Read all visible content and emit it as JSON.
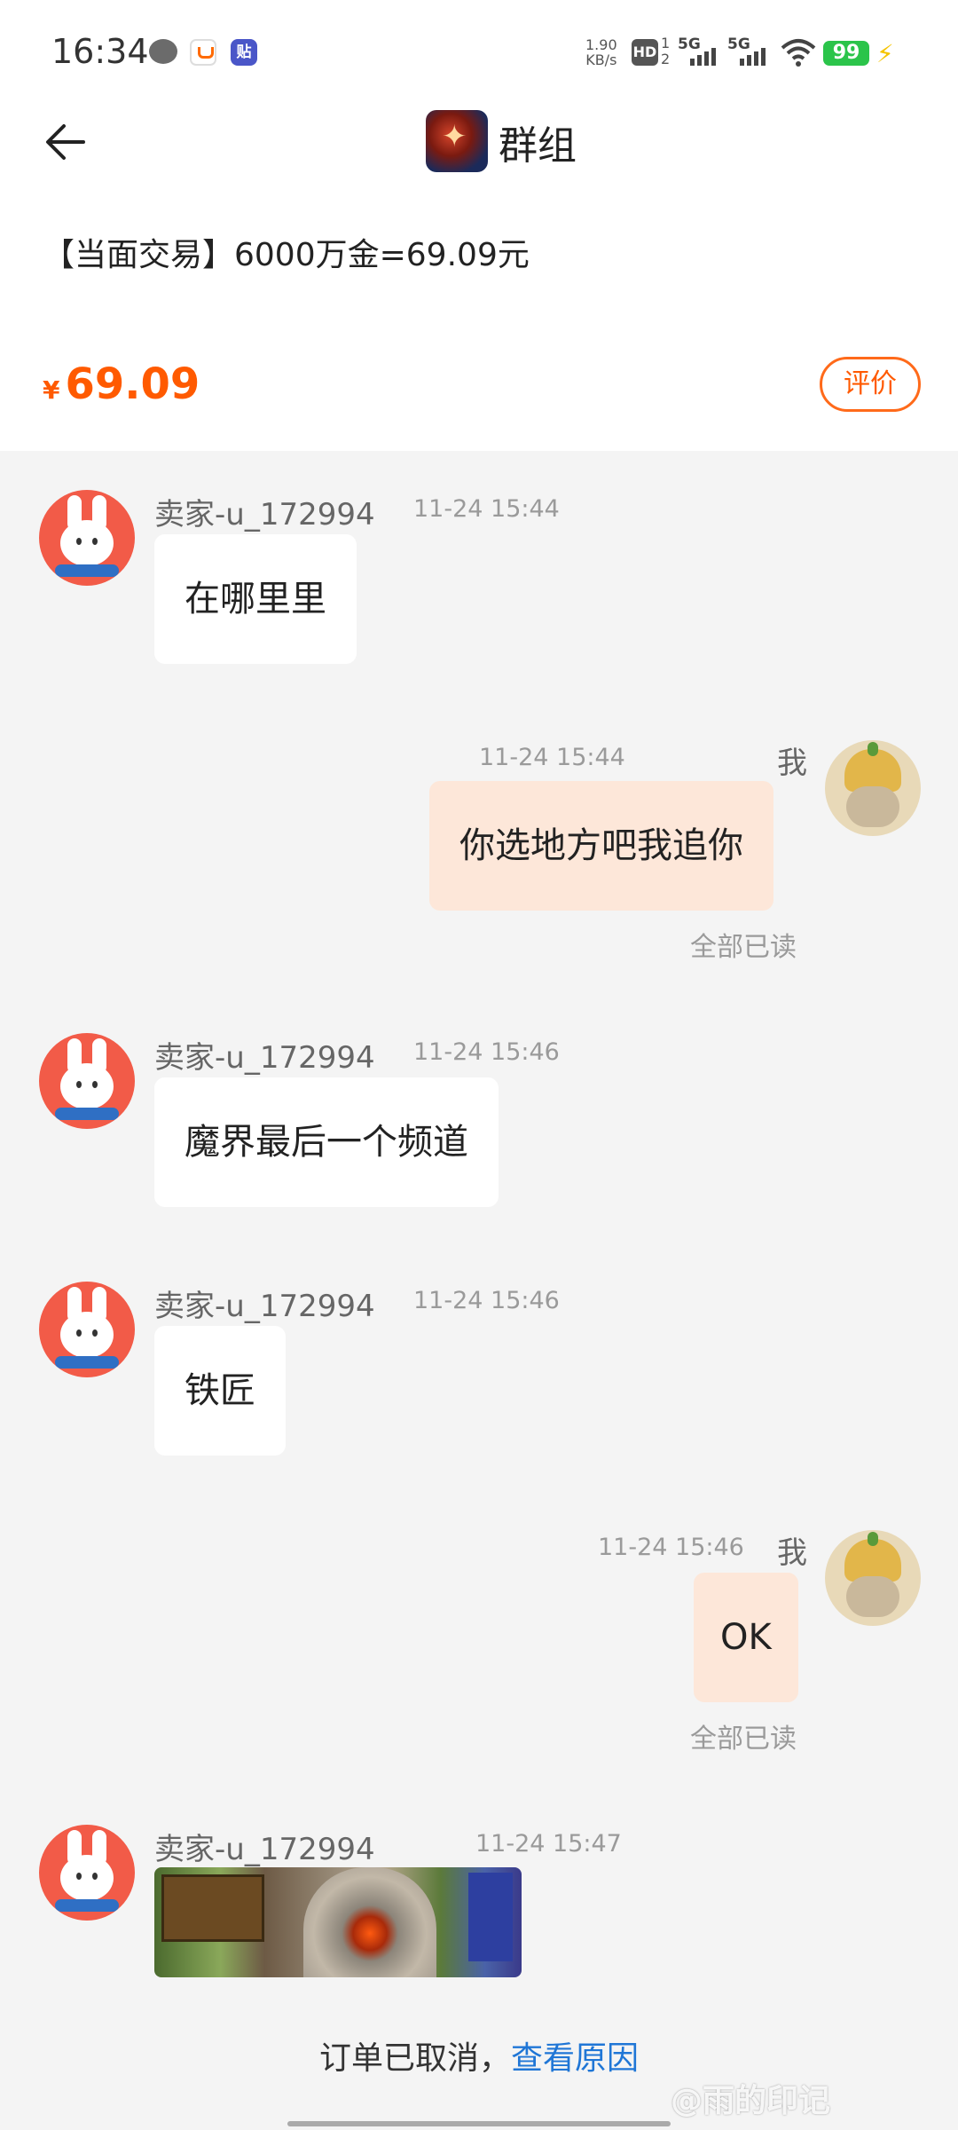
{
  "status_bar": {
    "time": "16:34",
    "net_speed": "1.90\nKB/s",
    "hd": "HD",
    "hd_sub": "1\n2",
    "sig1": "5G",
    "sig2": "5G",
    "battery": "99"
  },
  "header": {
    "title": "群组",
    "product_title": "【当面交易】6000万金=69.09元",
    "currency": "¥",
    "price": "69.09",
    "evaluate_label": "评价"
  },
  "messages": [
    {
      "sender": "卖家-u_172994",
      "time": "11-24 15:44",
      "text": "在哪里里"
    },
    {
      "sender": "我",
      "time": "11-24 15:44",
      "text": "你选地方吧我追你",
      "read": "全部已读"
    },
    {
      "sender": "卖家-u_172994",
      "time": "11-24 15:46",
      "text": "魔界最后一个频道"
    },
    {
      "sender": "卖家-u_172994",
      "time": "11-24 15:46",
      "text": "铁匠"
    },
    {
      "sender": "我",
      "time": "11-24 15:46",
      "text": "OK",
      "read": "全部已读"
    },
    {
      "sender": "卖家-u_172994",
      "time": "11-24 15:47",
      "image": "game-screenshot"
    }
  ],
  "footer": {
    "cancel_text": "订单已取消，",
    "reason_link": "查看原因",
    "watermark": "@雨的印记"
  },
  "colors": {
    "accent": "#ff5a00",
    "link": "#1f76d6",
    "my_bubble": "#fde7d9"
  }
}
